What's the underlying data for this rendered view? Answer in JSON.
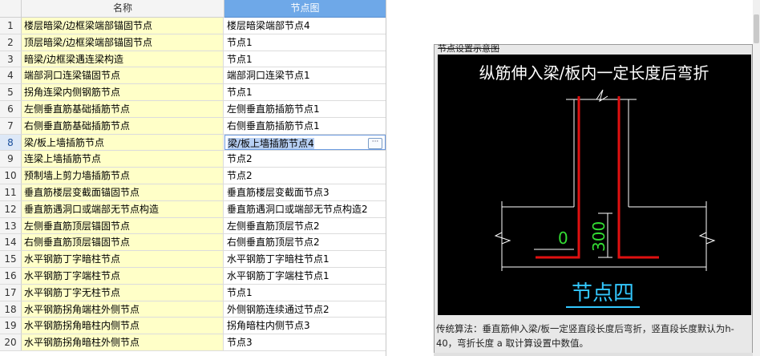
{
  "table": {
    "headers": {
      "name": "名称",
      "node": "节点图"
    },
    "selected_row": 8,
    "rows": [
      {
        "n": "1",
        "name": "楼层暗梁/边框梁端部锚固节点",
        "node": "楼层暗梁端部节点4"
      },
      {
        "n": "2",
        "name": "顶层暗梁/边框梁端部锚固节点",
        "node": "节点1"
      },
      {
        "n": "3",
        "name": "暗梁/边框梁遇连梁构造",
        "node": "节点1"
      },
      {
        "n": "4",
        "name": "端部洞口连梁锚固节点",
        "node": "端部洞口连梁节点1"
      },
      {
        "n": "5",
        "name": "拐角连梁内侧钢筋节点",
        "node": "节点1"
      },
      {
        "n": "6",
        "name": "左侧垂直筋基础插筋节点",
        "node": "左侧垂直筋插筋节点1"
      },
      {
        "n": "7",
        "name": "右侧垂直筋基础插筋节点",
        "node": "右侧垂直筋插筋节点1"
      },
      {
        "n": "8",
        "name": "梁/板上墙插筋节点",
        "node": "梁/板上墙插筋节点4"
      },
      {
        "n": "9",
        "name": "连梁上墙插筋节点",
        "node": "节点2"
      },
      {
        "n": "10",
        "name": "预制墙上剪力墙插筋节点",
        "node": "节点2"
      },
      {
        "n": "11",
        "name": "垂直筋楼层变截面锚固节点",
        "node": "垂直筋楼层变截面节点3"
      },
      {
        "n": "12",
        "name": "垂直筋遇洞口或端部无节点构造",
        "node": "垂直筋遇洞口或端部无节点构造2"
      },
      {
        "n": "13",
        "name": "左侧垂直筋顶层锚固节点",
        "node": "左侧垂直筋顶层节点2"
      },
      {
        "n": "14",
        "name": "右侧垂直筋顶层锚固节点",
        "node": "右侧垂直筋顶层节点2"
      },
      {
        "n": "15",
        "name": "水平钢筋丁字暗柱节点",
        "node": "水平钢筋丁字暗柱节点1"
      },
      {
        "n": "16",
        "name": "水平钢筋丁字端柱节点",
        "node": "水平钢筋丁字端柱节点1"
      },
      {
        "n": "17",
        "name": "水平钢筋丁字无柱节点",
        "node": "节点1"
      },
      {
        "n": "18",
        "name": "水平钢筋拐角端柱外侧节点",
        "node": "外侧钢筋连续通过节点2"
      },
      {
        "n": "19",
        "name": "水平钢筋拐角暗柱内侧节点",
        "node": "拐角暗柱内侧节点3"
      },
      {
        "n": "20",
        "name": "水平钢筋拐角暗柱外侧节点",
        "node": "节点3"
      }
    ],
    "ellipsis_label": "···"
  },
  "preview": {
    "panel_title": "节点设置示意图",
    "diagram_title": "纵筋伸入梁/板内一定长度后弯折",
    "dim_left": "0",
    "dim_vertical": "300",
    "node_label": "节点四",
    "description": "传统算法：垂直筋伸入梁/板一定竖直段长度后弯折，竖直段长度默认为h-40，弯折长度 a 取计算设置中数值。"
  },
  "colors": {
    "header_selected": "#6ea8e8",
    "name_cell_bg": "#ffffc8",
    "rebar": "#e01010",
    "dim_green": "#33dd33",
    "node_label": "#33c8ff"
  }
}
